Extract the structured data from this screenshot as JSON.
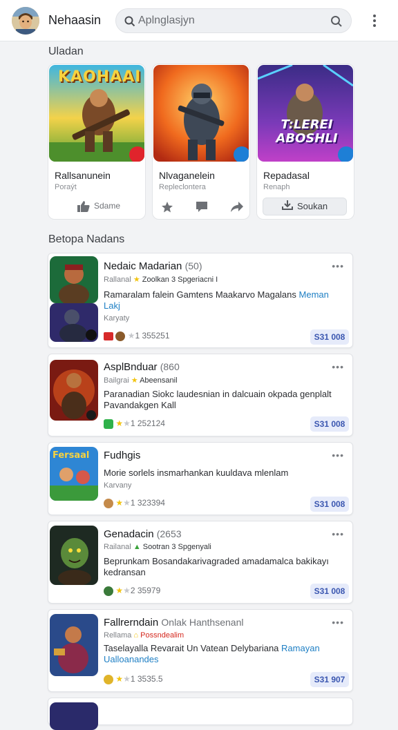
{
  "header": {
    "app_title": "Nehaasin",
    "search_placeholder": "Aplnglasjyn"
  },
  "featured": {
    "section_title": "Uladan",
    "items": [
      {
        "art_text": "KAOHAAI",
        "name": "Rallsanunein",
        "sub": "Poraýt",
        "action": "Sdame"
      },
      {
        "art_text": "",
        "name": "Nlvaganelein",
        "sub": "Repleclontera",
        "action": ""
      },
      {
        "art_text": "T:LEREI ABOSHLI",
        "name": "Repadasal",
        "sub": "Renaph",
        "action": "Soukan"
      }
    ]
  },
  "list": {
    "section_title": "Betopa Nadans",
    "items": [
      {
        "title": "Nedaic Madarian",
        "num": "(50)",
        "meta_a": "Rallanal",
        "meta_b": "Zoolkan 3 Spgeriacni I",
        "desc": "Ramaralam falein Gamtens Maakarvo Magalans",
        "desc_link": "Meman Lakj",
        "category": "Karyaty",
        "stats": "1 355251",
        "price": "S31 008"
      },
      {
        "title": "AsplBnduar",
        "num": "(860",
        "meta_a": "Bailgrai",
        "meta_b": "Abeensanil",
        "desc": "Paranadian Siokc laudesnian in dalcuain okpada genplalt Pavandakgen Kall",
        "desc_link": "",
        "category": "",
        "stats": "1 252124",
        "price": "S31 008"
      },
      {
        "title": "Fudhgis",
        "num": "",
        "meta_a": "",
        "meta_b": "",
        "desc": "Morie sorlels insmarhankan kuuldava mlenlam",
        "desc_link": "",
        "category": "Karvany",
        "stats": "1 323394",
        "price": "S31 008"
      },
      {
        "title": "Genadacin",
        "num": "(2653",
        "meta_a": "Railanal",
        "meta_b": "Sootran 3 Spgenyali",
        "desc": "Beprunkam Bosandakarivagraded amadamalca bakikayı kedransan",
        "desc_link": "",
        "category": "",
        "stats": "2 35979",
        "price": "S31 008"
      },
      {
        "title": "Fallrerndain",
        "num": "Onlak Hanthsenanl",
        "meta_a": "Rellama",
        "meta_b": "Possndealim",
        "desc": "Taselayalla Revarait Un Vatean Delybariana",
        "desc_link": "Ramayan Ualloanandes",
        "category": "",
        "stats": "1 3535.5",
        "price": "S31 907"
      }
    ]
  },
  "colors": {
    "accent": "#1e7fc4",
    "badge_bg": "#e6ebfa",
    "badge_text": "#3a56b0",
    "star": "#f2c40f"
  }
}
